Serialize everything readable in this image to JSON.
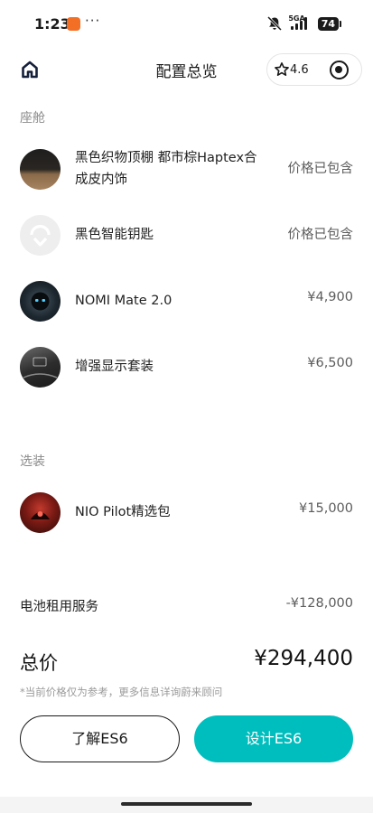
{
  "status_bar": {
    "time": "1:23",
    "dots": "···",
    "network": "5GA",
    "battery": "74"
  },
  "nav": {
    "title": "配置总览",
    "rating": "4.6"
  },
  "sections": {
    "cabin": {
      "title": "座舱",
      "items": [
        {
          "name": "黑色织物顶棚 都市棕Haptex合成皮内饰",
          "price": "价格已包含"
        },
        {
          "name": "黑色智能钥匙",
          "price": "价格已包含"
        },
        {
          "name": "NOMI Mate 2.0",
          "price": "¥4,900"
        },
        {
          "name": "增强显示套装",
          "price": "¥6,500"
        }
      ]
    },
    "optional": {
      "title": "选装",
      "items": [
        {
          "name": "NIO Pilot精选包",
          "price": "¥15,000"
        }
      ]
    }
  },
  "battery_service": {
    "label": "电池租用服务",
    "value": "-¥128,000"
  },
  "total": {
    "label": "总价",
    "value": "¥294,400"
  },
  "disclaimer": "*当前价格仅为参考，更多信息详询蔚来顾问",
  "buttons": {
    "learn": "了解ES6",
    "design": "设计ES6"
  },
  "colors": {
    "accent": "#00bebe",
    "app_icon": "#f36f26"
  }
}
